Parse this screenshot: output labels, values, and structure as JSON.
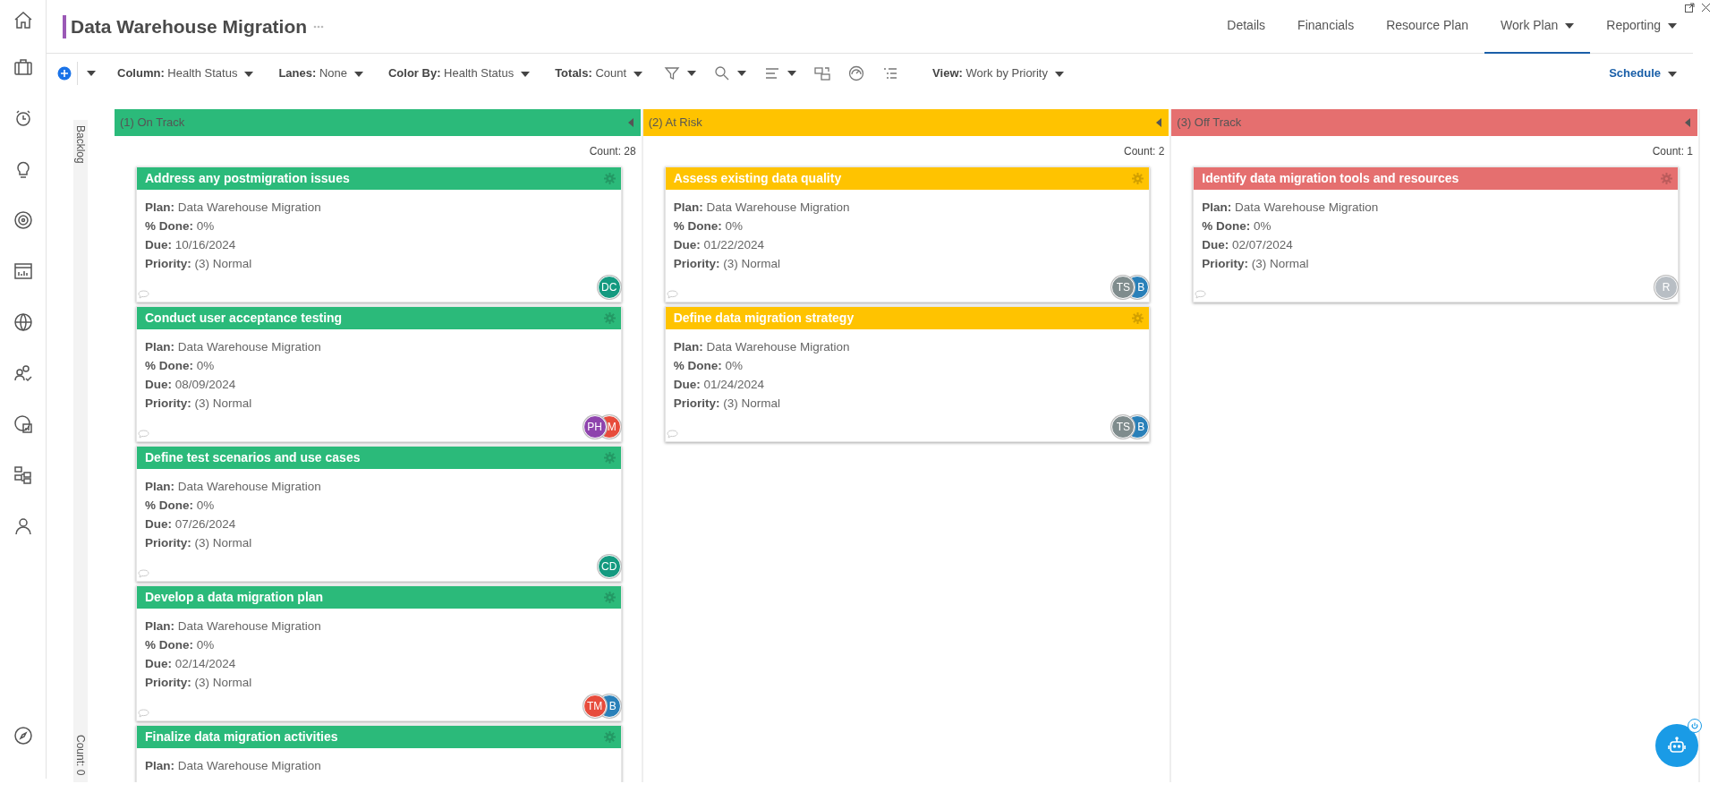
{
  "header": {
    "title": "Data Warehouse Migration"
  },
  "tabs": [
    {
      "label": "Details",
      "selected": false,
      "dropdown": false
    },
    {
      "label": "Financials",
      "selected": false,
      "dropdown": false
    },
    {
      "label": "Resource Plan",
      "selected": false,
      "dropdown": false
    },
    {
      "label": "Work Plan",
      "selected": true,
      "dropdown": true
    },
    {
      "label": "Reporting",
      "selected": false,
      "dropdown": true
    }
  ],
  "toolbar": {
    "selectors": [
      {
        "label": "Column:",
        "value": "Health Status"
      },
      {
        "label": "Lanes:",
        "value": "None"
      },
      {
        "label": "Color By:",
        "value": "Health Status"
      },
      {
        "label": "Totals:",
        "value": "Count"
      }
    ],
    "view": {
      "label": "View:",
      "value": "Work by Priority"
    },
    "schedule": "Schedule"
  },
  "backlog": {
    "title": "Backlog",
    "count": "Count: 0"
  },
  "columns": [
    {
      "title": "(1) On Track",
      "color": "#2bba7a",
      "count": "Count: 28",
      "cards": [
        {
          "title": "Address any postmigration issues",
          "fields": [
            {
              "label": "Plan:",
              "value": "Data Warehouse Migration"
            },
            {
              "label": "% Done:",
              "value": "0%"
            },
            {
              "label": "Due:",
              "value": "10/16/2024"
            },
            {
              "label": "Priority:",
              "value": "(3) Normal"
            }
          ],
          "avatars": [
            {
              "initials": "DC",
              "color": "#149a80"
            }
          ]
        },
        {
          "title": "Conduct user acceptance testing",
          "fields": [
            {
              "label": "Plan:",
              "value": "Data Warehouse Migration"
            },
            {
              "label": "% Done:",
              "value": "0%"
            },
            {
              "label": "Due:",
              "value": "08/09/2024"
            },
            {
              "label": "Priority:",
              "value": "(3) Normal"
            }
          ],
          "avatars": [
            {
              "initials": "PH",
              "color": "#8e44ad"
            },
            {
              "initials": "M",
              "color": "#e74c3c"
            }
          ]
        },
        {
          "title": "Define test scenarios and use cases",
          "fields": [
            {
              "label": "Plan:",
              "value": "Data Warehouse Migration"
            },
            {
              "label": "% Done:",
              "value": "0%"
            },
            {
              "label": "Due:",
              "value": "07/26/2024"
            },
            {
              "label": "Priority:",
              "value": "(3) Normal"
            }
          ],
          "avatars": [
            {
              "initials": "CD",
              "color": "#149a80"
            }
          ]
        },
        {
          "title": "Develop a data migration plan",
          "fields": [
            {
              "label": "Plan:",
              "value": "Data Warehouse Migration"
            },
            {
              "label": "% Done:",
              "value": "0%"
            },
            {
              "label": "Due:",
              "value": "02/14/2024"
            },
            {
              "label": "Priority:",
              "value": "(3) Normal"
            }
          ],
          "avatars": [
            {
              "initials": "TM",
              "color": "#e74c3c"
            },
            {
              "initials": "B",
              "color": "#2980b9"
            }
          ]
        },
        {
          "title": "Finalize data migration activities",
          "fields": [
            {
              "label": "Plan:",
              "value": "Data Warehouse Migration"
            }
          ]
        }
      ]
    },
    {
      "title": "(2) At Risk",
      "color": "#ffc300",
      "count": "Count: 2",
      "cards": [
        {
          "title": "Assess existing data quality",
          "fields": [
            {
              "label": "Plan:",
              "value": "Data Warehouse Migration"
            },
            {
              "label": "% Done:",
              "value": "0%"
            },
            {
              "label": "Due:",
              "value": "01/22/2024"
            },
            {
              "label": "Priority:",
              "value": "(3) Normal"
            }
          ],
          "avatars": [
            {
              "initials": "TS",
              "color": "#7f8c8d"
            },
            {
              "initials": "B",
              "color": "#2980b9"
            }
          ]
        },
        {
          "title": "Define data migration strategy",
          "fields": [
            {
              "label": "Plan:",
              "value": "Data Warehouse Migration"
            },
            {
              "label": "% Done:",
              "value": "0%"
            },
            {
              "label": "Due:",
              "value": "01/24/2024"
            },
            {
              "label": "Priority:",
              "value": "(3) Normal"
            }
          ],
          "avatars": [
            {
              "initials": "TS",
              "color": "#7f8c8d"
            },
            {
              "initials": "B",
              "color": "#2980b9"
            }
          ]
        }
      ]
    },
    {
      "title": "(3) Off Track",
      "color": "#e56f6f",
      "count": "Count: 1",
      "cards": [
        {
          "title": "Identify data migration tools and resources",
          "fields": [
            {
              "label": "Plan:",
              "value": "Data Warehouse Migration"
            },
            {
              "label": "% Done:",
              "value": "0%"
            },
            {
              "label": "Due:",
              "value": "02/07/2024"
            },
            {
              "label": "Priority:",
              "value": "(3) Normal"
            }
          ],
          "avatars": [
            {
              "initials": "R",
              "color": "#b8bec4"
            }
          ]
        }
      ]
    }
  ]
}
